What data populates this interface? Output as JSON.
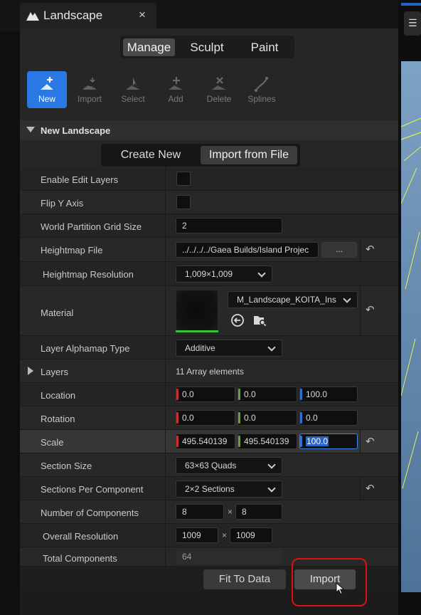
{
  "tab": {
    "title": "Landscape",
    "close": "×",
    "icon": "landscape-icon"
  },
  "modes": [
    "Manage",
    "Sculpt",
    "Paint"
  ],
  "tools": [
    {
      "label": "New",
      "icon": "new-plus-icon",
      "active": true
    },
    {
      "label": "Import",
      "icon": "import-grid-icon",
      "active": false
    },
    {
      "label": "Select",
      "icon": "select-cursor-icon",
      "active": false
    },
    {
      "label": "Add",
      "icon": "add-plus-icon",
      "active": false
    },
    {
      "label": "Delete",
      "icon": "delete-x-icon",
      "active": false
    },
    {
      "label": "Splines",
      "icon": "splines-icon",
      "active": false
    }
  ],
  "section": {
    "title": "New Landscape"
  },
  "create_modes": [
    "Create New",
    "Import from File"
  ],
  "properties": {
    "enable_edit_layers": {
      "label": "Enable Edit Layers",
      "checked": false
    },
    "flip_y": {
      "label": "Flip Y Axis",
      "checked": false
    },
    "wp_grid": {
      "label": "World Partition Grid Size",
      "value": "2"
    },
    "heightmap_file": {
      "label": "Heightmap File",
      "value": "../../../../Gaea Builds/Island Projec",
      "browse": "..."
    },
    "heightmap_res": {
      "label": "Heightmap Resolution",
      "value": "1,009×1,009"
    },
    "material": {
      "label": "Material",
      "value": "M_Landscape_KOITA_Ins"
    },
    "alphamap": {
      "label": "Layer Alphamap Type",
      "value": "Additive"
    },
    "layers": {
      "label": "Layers",
      "value": "11 Array elements"
    },
    "location": {
      "label": "Location",
      "x": "0.0",
      "y": "0.0",
      "z": "100.0"
    },
    "rotation": {
      "label": "Rotation",
      "x": "0.0",
      "y": "0.0",
      "z": "0.0"
    },
    "scale": {
      "label": "Scale",
      "x": "495.540139",
      "y": "495.540139",
      "z": "100.0"
    },
    "section_size": {
      "label": "Section Size",
      "value": "63×63 Quads"
    },
    "sections_per_comp": {
      "label": "Sections Per Component",
      "value": "2×2 Sections"
    },
    "num_components": {
      "label": "Number of Components",
      "x": "8",
      "y": "8",
      "sep": "×"
    },
    "overall_res": {
      "label": "Overall Resolution",
      "x": "1009",
      "y": "1009",
      "sep": "×"
    },
    "total_components": {
      "label": "Total Components",
      "value": "64"
    }
  },
  "buttons": {
    "fit": "Fit To Data",
    "import": "Import"
  },
  "colors": {
    "accent": "#2a78e4",
    "x_axis": "#c8302c",
    "y_axis": "#5fa33a",
    "z_axis": "#2f6fd0",
    "annotation": "#e01010"
  }
}
